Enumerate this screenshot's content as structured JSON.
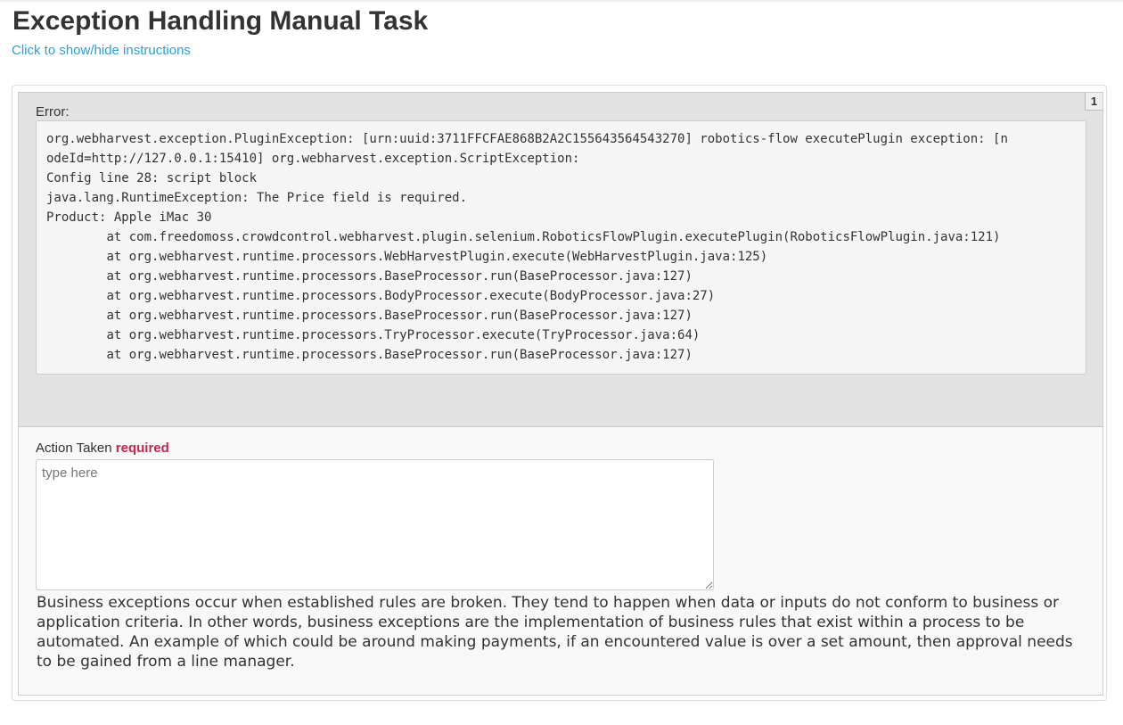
{
  "page": {
    "title": "Exception Handling Manual Task",
    "toggle_instructions": "Click to show/hide instructions"
  },
  "panel": {
    "badge": "1",
    "error_label": "Error:",
    "error_text": "org.webharvest.exception.PluginException: [urn:uuid:3711FFCFAE868B2A2C155643564543270] robotics-flow executePlugin exception: [n\nodeId=http://127.0.0.1:15410] org.webharvest.exception.ScriptException:\nConfig line 28: script block\njava.lang.RuntimeException: The Price field is required.\nProduct: Apple iMac 30\n\tat com.freedomoss.crowdcontrol.webharvest.plugin.selenium.RoboticsFlowPlugin.executePlugin(RoboticsFlowPlugin.java:121)\n\tat org.webharvest.runtime.processors.WebHarvestPlugin.execute(WebHarvestPlugin.java:125)\n\tat org.webharvest.runtime.processors.BaseProcessor.run(BaseProcessor.java:127)\n\tat org.webharvest.runtime.processors.BodyProcessor.execute(BodyProcessor.java:27)\n\tat org.webharvest.runtime.processors.BaseProcessor.run(BaseProcessor.java:127)\n\tat org.webharvest.runtime.processors.TryProcessor.execute(TryProcessor.java:64)\n\tat org.webharvest.runtime.processors.BaseProcessor.run(BaseProcessor.java:127)",
    "action_label": "Action Taken",
    "required_label": "required",
    "action_placeholder": "type here",
    "action_value": "",
    "description": "Business exceptions occur when established rules are broken. They tend to happen when data or inputs do not conform to business or application criteria. In other words, business exceptions are the implementation of business rules that exist within a process to be automated.  An example of which could be around making payments, if an encountered value is over a set amount, then approval needs to be gained from a line manager."
  },
  "colors": {
    "link": "#2a9fd6",
    "required": "#c7254e",
    "error_section_bg": "#e2e2e2"
  }
}
